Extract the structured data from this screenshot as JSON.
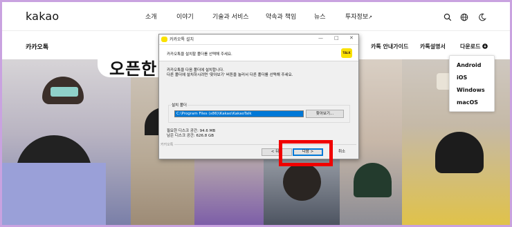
{
  "nav": {
    "logo": "kakao",
    "links": [
      "소개",
      "이야기",
      "기술과 서비스",
      "약속과 책임",
      "뉴스",
      "투자정보"
    ],
    "external_icon": "↗"
  },
  "subnav": {
    "title": "카카오톡",
    "items": [
      "카톡 안내가이드",
      "카톡설명서",
      "다운로드"
    ]
  },
  "hero": {
    "bubble_text": "오픈한"
  },
  "dropdown": {
    "options": [
      "Android",
      "iOS",
      "Windows",
      "macOS"
    ]
  },
  "dialog": {
    "title": "카카오톡 설치",
    "window_controls": [
      "—",
      "□",
      "✕"
    ],
    "header": "카카오톡을 설치할 폴더를 선택해 주세요.",
    "logo_text": "TALK",
    "desc_line1": "카카오톡을 다음 폴더에 설치합니다.",
    "desc_line2": "다른 폴더에 설치하시려면 '찾아보기' 버튼을 눌러서 다른 폴더를 선택해 주세요.",
    "group_label": "설치 폴더",
    "path_value": "C:\\Program Files (x86)\\Kakao\\KakaoTalk",
    "browse_label": "찾아보기...",
    "required_space": "필요한 디스크 공간: 94.6 MB",
    "available_space": "남은 디스크 공간: 626.8 GB",
    "footer_label": "카카오톡",
    "back_label": "< 뒤로",
    "next_label": "다음 >",
    "cancel_label": "취소"
  },
  "colors": {
    "frame_border": "#c9a2e0",
    "kakao_yellow": "#fae100",
    "highlight_red": "#f00000",
    "selection_blue": "#0078d7"
  }
}
